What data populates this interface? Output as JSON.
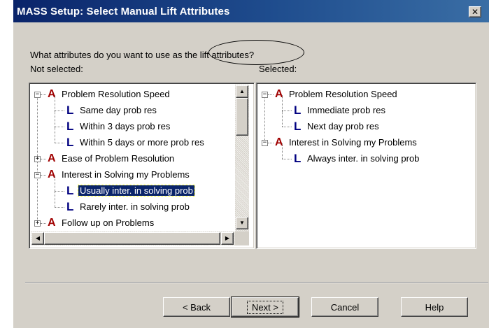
{
  "window": {
    "title": "MASS Setup: Select Manual Lift Attributes",
    "close_glyph": "✕"
  },
  "prompt": {
    "question": "What attributes do you want to use as the lift attributes?",
    "not_selected_label": "Not selected:",
    "selected_label": "Selected:"
  },
  "not_selected_tree": [
    {
      "type": "attribute",
      "expanded": true,
      "label": "Problem Resolution Speed"
    },
    {
      "type": "level",
      "label": "Same day prob res"
    },
    {
      "type": "level",
      "label": "Within 3 days prob res"
    },
    {
      "type": "level",
      "label": "Within 5 days or more prob res"
    },
    {
      "type": "attribute",
      "expanded": false,
      "label": "Ease of Problem Resolution"
    },
    {
      "type": "attribute",
      "expanded": true,
      "label": "Interest in Solving my Problems"
    },
    {
      "type": "level",
      "label": "Usually inter. in solving prob",
      "selected": true
    },
    {
      "type": "level",
      "label": "Rarely inter. in solving prob"
    },
    {
      "type": "attribute",
      "expanded": false,
      "label": "Follow up on Problems"
    }
  ],
  "selected_tree": [
    {
      "type": "attribute",
      "expanded": true,
      "label": "Problem Resolution Speed"
    },
    {
      "type": "level",
      "label": "Immediate prob res"
    },
    {
      "type": "level",
      "label": "Next day prob res"
    },
    {
      "type": "attribute",
      "expanded": true,
      "label": "Interest in Solving my Problems"
    },
    {
      "type": "level",
      "label": "Always inter. in solving prob"
    }
  ],
  "icons": {
    "attribute_glyph": "A",
    "level_glyph": "L",
    "expand_glyph": "+",
    "collapse_glyph": "−",
    "scroll_up": "▲",
    "scroll_down": "▼",
    "scroll_left": "◀",
    "scroll_right": "▶"
  },
  "buttons": {
    "back": "< Back",
    "next": "Next >",
    "cancel": "Cancel",
    "help": "Help"
  },
  "colors": {
    "titlebar_start": "#0a246a",
    "attribute_icon": "#a00000",
    "level_icon": "#000080",
    "selection": "#0a246a"
  }
}
